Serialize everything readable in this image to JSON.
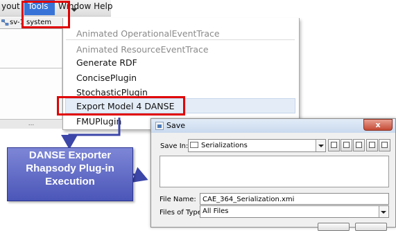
{
  "menubar": {
    "layout_label": "yout",
    "tools_label": "Tools",
    "ghost_label": "Window   Help"
  },
  "tab": {
    "label": "sv-1 system"
  },
  "dropdown": {
    "items": [
      {
        "label": "Animated OperationalEventTrace",
        "enabled": false
      },
      {
        "label": "Animated ResourceEventTrace",
        "enabled": false
      },
      {
        "label": "Generate RDF",
        "enabled": true
      },
      {
        "label": "ConcisePlugin",
        "enabled": true
      },
      {
        "label": "StochasticPlugin",
        "enabled": true
      },
      {
        "label": "Export Model 4 DANSE",
        "enabled": true
      },
      {
        "label": "FMUPlugin",
        "enabled": true
      }
    ]
  },
  "bottom_strip": {
    "label": "..."
  },
  "save_dialog": {
    "title": "Save",
    "close_label": "x",
    "save_in_label": "Save In:",
    "save_in_value": "Serializations",
    "file_name_label": "File Name:",
    "file_name_value": "CAE_364_Serialization.xmi",
    "files_of_type_label": "Files of Type:",
    "files_of_type_value": "All Files"
  },
  "callout": {
    "line1": "DANSE Exporter",
    "line2": "Rhapsody Plug-in",
    "line3": "Execution"
  },
  "colors": {
    "highlight": "#e00000",
    "callout_fill": "#5a63c4",
    "menu_selected": "#3874d8"
  }
}
